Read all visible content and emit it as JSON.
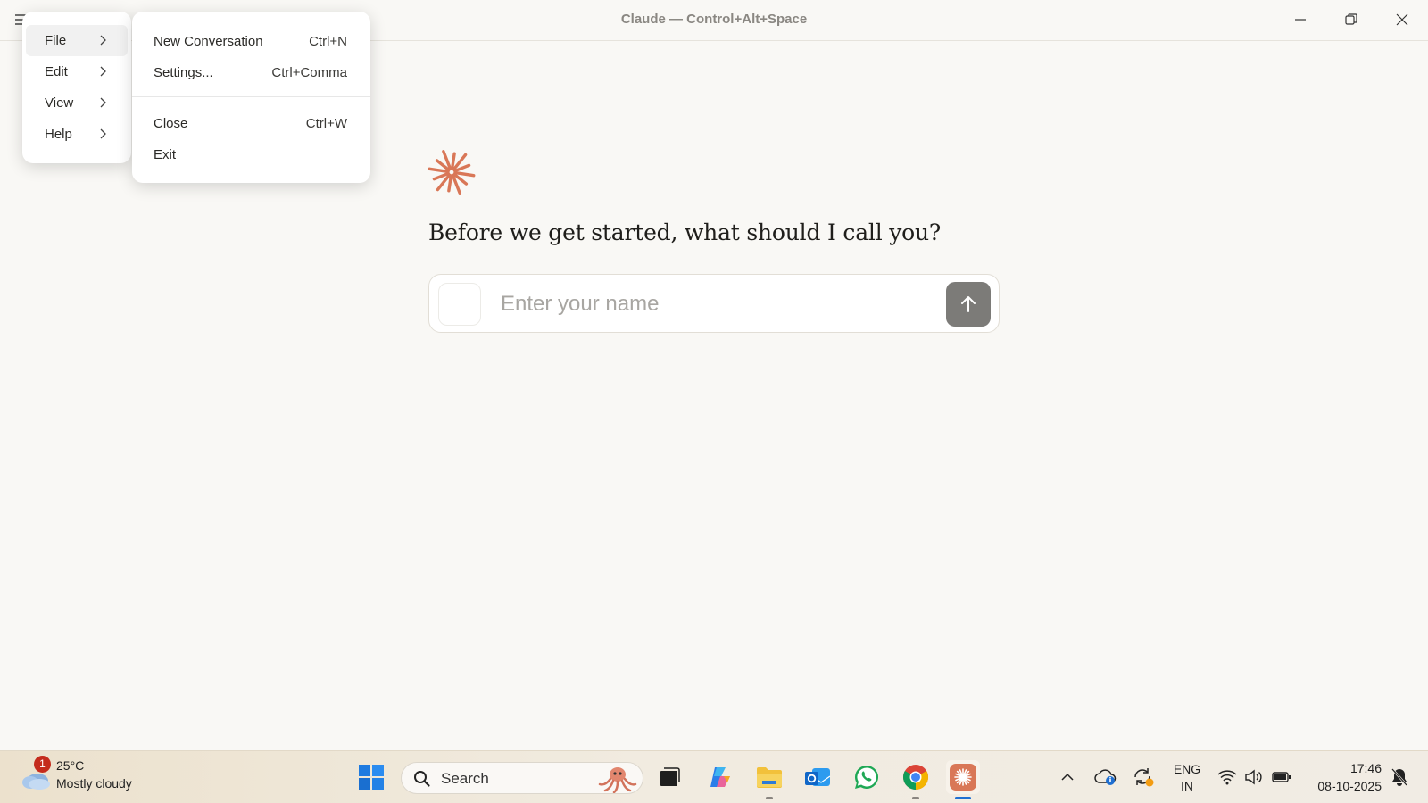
{
  "window": {
    "title": "Claude — Control+Alt+Space"
  },
  "menus": {
    "main": [
      {
        "label": "File",
        "active": true
      },
      {
        "label": "Edit",
        "active": false
      },
      {
        "label": "View",
        "active": false
      },
      {
        "label": "Help",
        "active": false
      }
    ],
    "file": [
      {
        "label": "New Conversation",
        "shortcut": "Ctrl+N"
      },
      {
        "label": "Settings...",
        "shortcut": "Ctrl+Comma"
      },
      {
        "label": "Close",
        "shortcut": "Ctrl+W"
      },
      {
        "label": "Exit",
        "shortcut": ""
      }
    ]
  },
  "main": {
    "greeting": "Before we get started, what should I call you?",
    "name_placeholder": "Enter your name",
    "name_value": ""
  },
  "colors": {
    "brand": "#d97757",
    "send_button": "#7c7b78"
  },
  "taskbar": {
    "weather": {
      "temp": "25°C",
      "desc": "Mostly cloudy",
      "badge": "1"
    },
    "search_label": "Search",
    "lang_line1": "ENG",
    "lang_line2": "IN",
    "time": "17:46",
    "date": "08-10-2025"
  }
}
